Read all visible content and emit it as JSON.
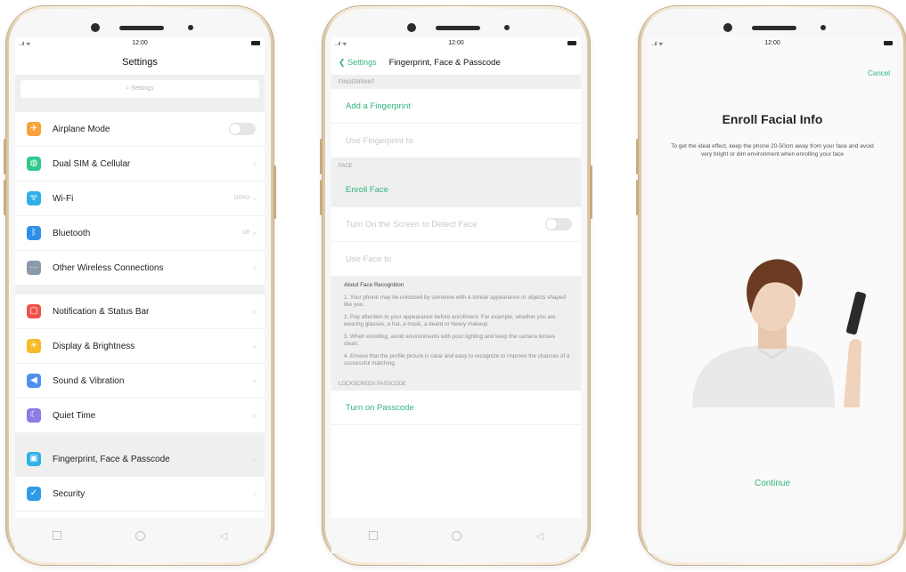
{
  "status": {
    "time": "12:00",
    "signal": "..ıl ᯤ"
  },
  "phone1": {
    "title": "Settings",
    "search_placeholder": "Settings",
    "group1": [
      {
        "label": "Airplane Mode",
        "icon": "airplane-icon",
        "color": "#f5a33a",
        "glyph": "✈",
        "trail": "toggle"
      },
      {
        "label": "Dual SIM & Cellular",
        "icon": "globe-icon",
        "color": "#2fc98c",
        "glyph": "◍",
        "trail": "chevron"
      },
      {
        "label": "Wi-Fi",
        "icon": "wifi-icon",
        "color": "#2fb1e8",
        "glyph": "ᯤ",
        "value": "OPPO",
        "trail": "chevron"
      },
      {
        "label": "Bluetooth",
        "icon": "bluetooth-icon",
        "color": "#2f8ee8",
        "glyph": "ᛒ",
        "value": "Off",
        "trail": "chevron"
      },
      {
        "label": "Other Wireless Connections",
        "icon": "more-icon",
        "color": "#8a9aa8",
        "glyph": "···",
        "trail": "chevron"
      }
    ],
    "group2": [
      {
        "label": "Notification & Status Bar",
        "icon": "notification-icon",
        "color": "#f0524b",
        "glyph": "▢",
        "trail": "chevron"
      },
      {
        "label": "Display & Brightness",
        "icon": "display-icon",
        "color": "#f6b928",
        "glyph": "☀",
        "trail": "chevron"
      },
      {
        "label": "Sound & Vibration",
        "icon": "sound-icon",
        "color": "#4f8ff0",
        "glyph": "◀",
        "trail": "chevron"
      },
      {
        "label": "Quiet Time",
        "icon": "moon-icon",
        "color": "#8b7be4",
        "glyph": "☾",
        "trail": "chevron"
      }
    ],
    "group3": [
      {
        "label": "Fingerprint, Face & Passcode",
        "icon": "fingerprint-icon",
        "color": "#2fb1e8",
        "glyph": "▣",
        "trail": "chevron",
        "selected": true
      },
      {
        "label": "Security",
        "icon": "shield-icon",
        "color": "#2f9be8",
        "glyph": "✓",
        "trail": "chevron"
      }
    ]
  },
  "phone2": {
    "back": "Settings",
    "title": "Fingerprint, Face & Passcode",
    "section_fingerprint": "FINGERPRINT",
    "add_fingerprint": "Add a Fingerprint",
    "use_fingerprint": "Use Fingerprint to",
    "section_face": "FACE",
    "enroll_face": "Enroll Face",
    "turn_on_screen": "Turn On the Screen to Detect Face",
    "use_face": "Use Face to",
    "about_title": "About Face Recognition",
    "about_items": [
      "1. Your phone may be unlocked by someone with a similar appearance or objects shaped like you.",
      "2. Pay attention to your appearance before enrollment. For example, whether you are wearing glasses, a hat, a mask, a beard or heavy makeup.",
      "3. When enrolling, avoid environments with poor lighting and keep the camera lenses clean.",
      "4. Ensure that the profile picture is clear and easy to recognize to improve the chances of a successful matching."
    ],
    "section_lockscreen": "LOCKSCREEN PASSCODE",
    "turn_on_passcode": "Turn on Passcode"
  },
  "phone3": {
    "cancel": "Cancel",
    "title": "Enroll Facial Info",
    "description": "To get the ideal effect, keep the phone 20-50cm away from your face and avoid very bright or dim environment when enrolling your face",
    "continue": "Continue"
  },
  "colors": {
    "accent": "#2fb57b",
    "frame": "#e9d9c2"
  }
}
